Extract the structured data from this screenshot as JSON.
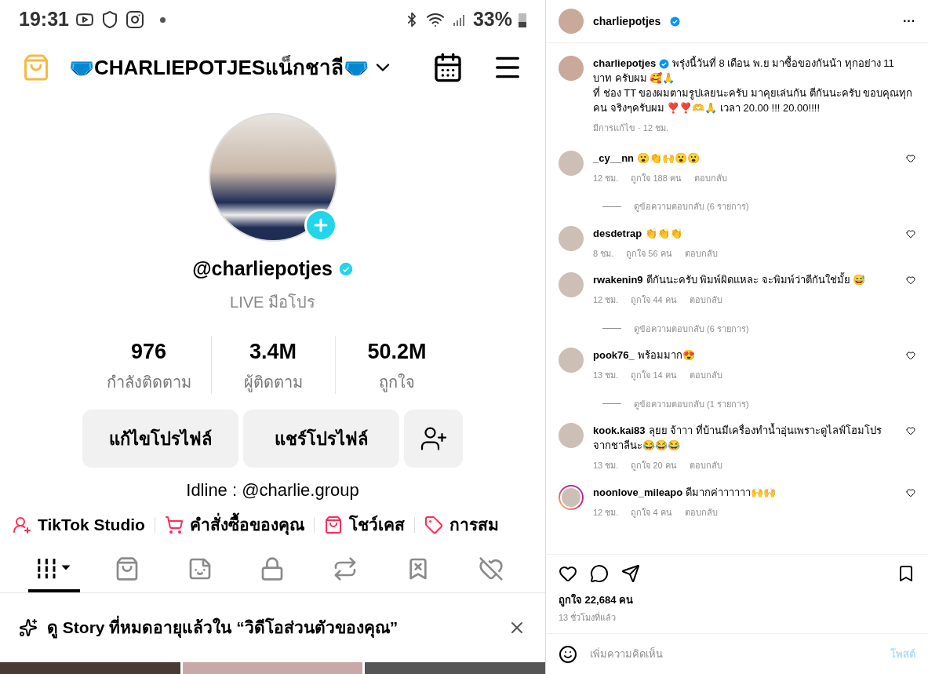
{
  "phone": {
    "status_bar": {
      "time": "19:31",
      "battery": "33%"
    },
    "header": {
      "username": "🩲CHARLIEPOTJESแน็กชาลี🩲"
    },
    "profile": {
      "handle": "@charliepotjes",
      "verified": true,
      "subtitle": "LIVE มือโปร",
      "stats": [
        {
          "value": "976",
          "label": "กำลังติดตาม"
        },
        {
          "value": "3.4M",
          "label": "ผู้ติดตาม"
        },
        {
          "value": "50.2M",
          "label": "ถูกใจ"
        }
      ],
      "buttons": [
        "แก้ไขโปรไฟล์",
        "แชร์โปรไฟล์"
      ],
      "bio": "Idline : @charlie.group",
      "shortcuts": [
        {
          "kind": "studio",
          "label": "TikTok Studio"
        },
        {
          "kind": "orders",
          "label": "คำสั่งซื้อของคุณ"
        },
        {
          "kind": "showcase",
          "label": "โชว์เคส"
        },
        {
          "kind": "promote",
          "label": "การสม"
        }
      ]
    },
    "tabs": [
      {
        "kind": "videos",
        "selected": true
      },
      {
        "kind": "shop",
        "selected": false
      },
      {
        "kind": "sticker",
        "selected": false
      },
      {
        "kind": "private",
        "selected": false
      },
      {
        "kind": "repost",
        "selected": false
      },
      {
        "kind": "favorites",
        "selected": false
      },
      {
        "kind": "liked",
        "selected": false
      }
    ],
    "story_banner": {
      "text": "ดู Story ที่หมดอายุแล้วใน “วิดีโอส่วนตัวของคุณ”"
    }
  },
  "post": {
    "header": {
      "username": "charliepotjes",
      "verified": true,
      "more": "···"
    },
    "caption": {
      "username": "charliepotjes",
      "verified": true,
      "text": "พรุ่งนี้วันที่ 8 เดือน พ.ย มาซื้อของกันน้า ทุกอย่าง 11 บาท ครับผม 🥰🙏\nที่ ช่อง TT ของผมตามรูปเลยนะครับ มาคุยเล่นกัน ตีกันนะครับ ขอบคุณทุกคน จริงๆครับผม ❣️❣️🫶🙏 เวลา 20.00 !!! 20.00!!!!",
      "meta": "มีการแก้ไข · 12 ชม."
    },
    "comments": [
      {
        "username": "_cy__nn",
        "text": "😮👏🙌😮😮",
        "time": "12 ชม.",
        "likes": "ถูกใจ 188 คน",
        "reply": "ตอบกลับ",
        "story_ring": false,
        "view_replies": "ดูข้อความตอบกลับ (6 รายการ)"
      },
      {
        "username": "desdetrap",
        "text": "👏👏👏",
        "time": "8 ชม.",
        "likes": "ถูกใจ 56 คน",
        "reply": "ตอบกลับ",
        "story_ring": false
      },
      {
        "username": "rwakenin9",
        "text": "ตีกันนะครับ พิมพ์ผิดแหละ จะพิมพ์ว่าตีกันใช่มั้ย 😅",
        "time": "12 ชม.",
        "likes": "ถูกใจ 44 คน",
        "reply": "ตอบกลับ",
        "story_ring": false,
        "view_replies": "ดูข้อความตอบกลับ (6 รายการ)"
      },
      {
        "username": "pook76_",
        "text": "พร้อมมาก😍",
        "time": "13 ชม.",
        "likes": "ถูกใจ 14 คน",
        "reply": "ตอบกลับ",
        "story_ring": false,
        "view_replies": "ดูข้อความตอบกลับ (1 รายการ)"
      },
      {
        "username": "kook.kai83",
        "text": "ลุยย จ้าาา ที่บ้านมีเครื่องทำน้ำอุ่นเพราะดูไลฟ์โฮมโปรจากชาลีนะ😂😂😂",
        "time": "13 ชม.",
        "likes": "ถูกใจ 20 คน",
        "reply": "ตอบกลับ",
        "story_ring": false
      },
      {
        "username": "noonlove_mileapo",
        "text": "ดีมากค่าาาาาา🙌🙌",
        "time": "12 ชม.",
        "likes": "ถูกใจ 4 คน",
        "reply": "ตอบกลับ",
        "story_ring": true
      }
    ],
    "likes": "ถูกใจ 22,684 คน",
    "posted": "13 ชั่วโมงที่แล้ว",
    "comment_input": {
      "placeholder": "เพิ่มความคิดเห็น",
      "post_button": "โพสต์"
    }
  }
}
